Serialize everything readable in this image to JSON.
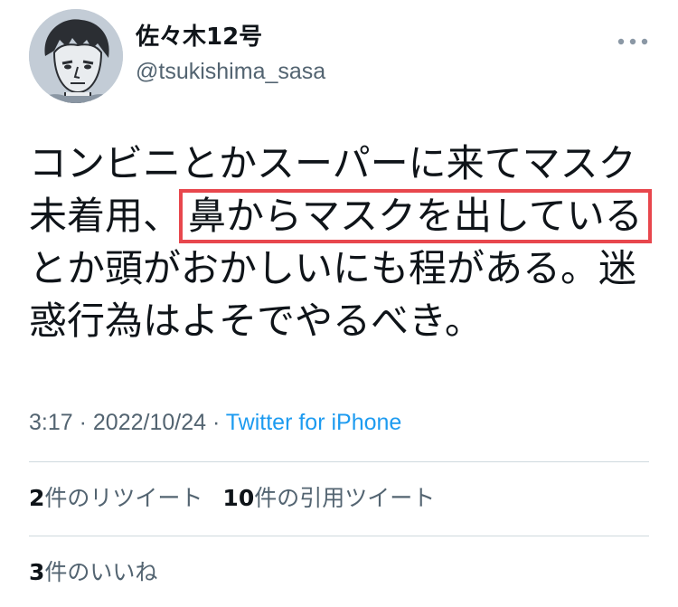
{
  "user": {
    "display_name": "佐々木12号",
    "handle": "@tsukishima_sasa"
  },
  "tweet": {
    "text_before": "コンビニとかスーパーに来てマスク未着用、",
    "text_highlight": "鼻からマスクを出している",
    "text_after": "とか頭がおかしいにも程がある。迷惑行為はよそでやるべき。"
  },
  "meta": {
    "time": "3:17",
    "separator": " · ",
    "date": "2022/10/24",
    "source": "Twitter for iPhone"
  },
  "stats": {
    "retweets_count": "2",
    "retweets_label": "件のリツイート",
    "quotes_count": "10",
    "quotes_label": "件の引用ツイート",
    "likes_count": "3",
    "likes_label": "件のいいね"
  },
  "icons": {
    "more": "more-horizontal-icon",
    "avatar": "avatar-image"
  },
  "colors": {
    "highlight_box": "#e8474d",
    "link": "#1d9bf0",
    "secondary_text": "#536471"
  }
}
